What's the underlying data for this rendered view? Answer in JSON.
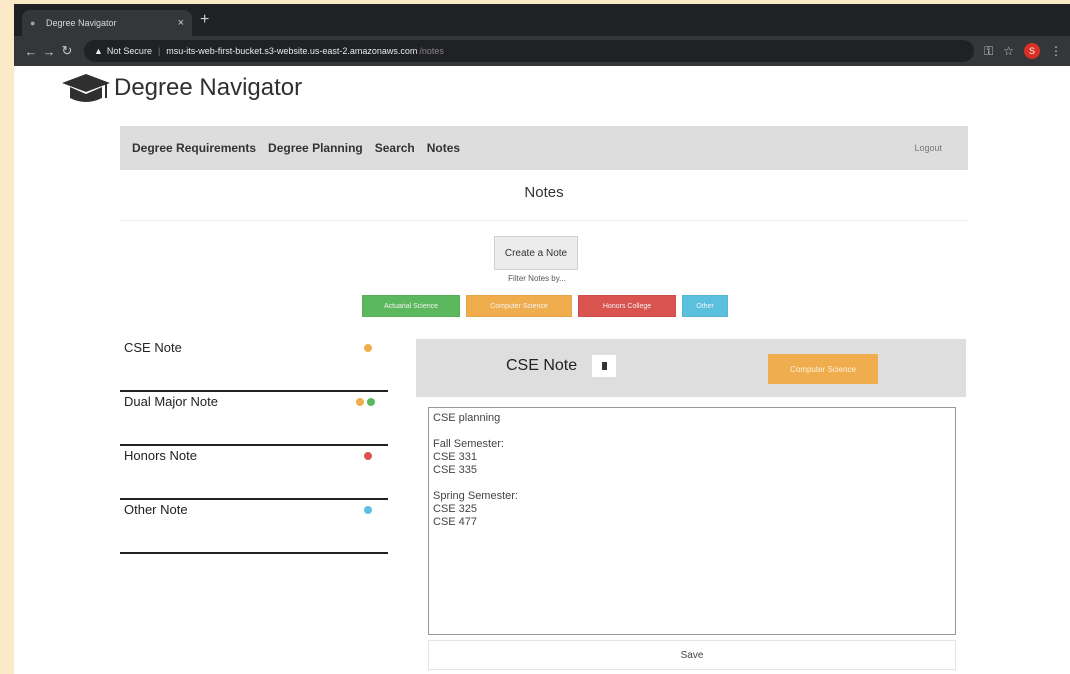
{
  "browser": {
    "tab_title": "Degree Navigator",
    "tab_close": "×",
    "new_tab": "+",
    "address": {
      "warning": "▲",
      "not_secure": "Not Secure",
      "separator": "|",
      "url": "msu-its-web-first-bucket.s3-website.us-east-2.amazonaws.com",
      "path": "/notes"
    },
    "profile_initial": "S"
  },
  "app": {
    "title": "Degree Navigator"
  },
  "navbar": {
    "links": [
      "Degree Requirements",
      "Degree Planning",
      "Search",
      "Notes"
    ],
    "logout": "Logout"
  },
  "notes": {
    "heading": "Notes",
    "create_button": "Create a Note",
    "filter_label": "Filter Notes by...",
    "filters": [
      {
        "label": "Actuarial Science",
        "color": "#5cb85c"
      },
      {
        "label": "Computer Science",
        "color": "#f0ad4e"
      },
      {
        "label": "Honors College",
        "color": "#d9534f"
      },
      {
        "label": "Other",
        "color": "#5bc0de"
      }
    ],
    "list": [
      {
        "title": "CSE Note",
        "dots": [
          "#f0ad4e"
        ]
      },
      {
        "title": "Dual Major Note",
        "dots": [
          "#f0ad4e",
          "#5cb85c"
        ]
      },
      {
        "title": "Honors Note",
        "dots": [
          "#d9534f"
        ]
      },
      {
        "title": "Other Note",
        "dots": [
          "#5bc0de"
        ]
      }
    ]
  },
  "editor": {
    "title": "CSE Note",
    "tag": "Computer Science",
    "tag_color": "#f0ad4e",
    "body": "CSE planning\n\nFall Semester:\nCSE 331\nCSE 335\n\nSpring Semester:\nCSE 325\nCSE 477",
    "save_label": "Save"
  }
}
